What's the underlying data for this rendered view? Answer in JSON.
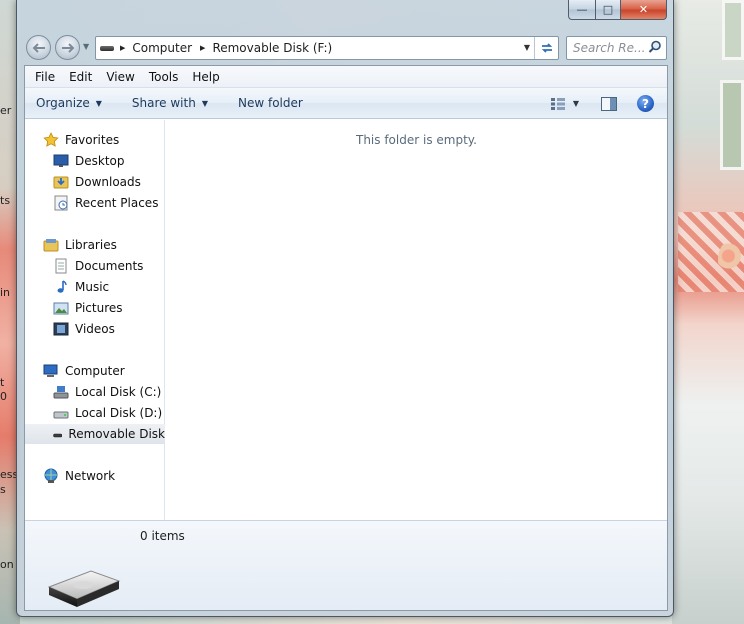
{
  "window": {
    "caption": {
      "minimize": "—",
      "maximize": "□",
      "close": "✕"
    }
  },
  "address": {
    "crumbs": [
      "Computer",
      "Removable Disk (F:)"
    ],
    "search_placeholder": "Search Re..."
  },
  "menu": [
    "File",
    "Edit",
    "View",
    "Tools",
    "Help"
  ],
  "commands": {
    "organize": "Organize",
    "share_with": "Share with",
    "new_folder": "New folder"
  },
  "navigation": {
    "favorites": {
      "label": "Favorites",
      "items": [
        "Desktop",
        "Downloads",
        "Recent Places"
      ]
    },
    "libraries": {
      "label": "Libraries",
      "items": [
        "Documents",
        "Music",
        "Pictures",
        "Videos"
      ]
    },
    "computer": {
      "label": "Computer",
      "items": [
        "Local Disk (C:)",
        "Local Disk (D:)",
        "Removable Disk"
      ],
      "selected": "Removable Disk"
    },
    "network": {
      "label": "Network"
    }
  },
  "content": {
    "empty_message": "This folder is empty."
  },
  "details": {
    "item_count": "0 items"
  },
  "desktop": {
    "left_fragments": [
      "er",
      "ts",
      "in",
      "t",
      "0",
      "ess",
      "s",
      "on"
    ]
  },
  "icons": {
    "back": "arrow-left-icon",
    "forward": "arrow-right-icon",
    "refresh": "refresh-icon",
    "search": "search-icon",
    "views": "views-icon",
    "preview": "preview-pane-icon",
    "help": "help-icon"
  }
}
